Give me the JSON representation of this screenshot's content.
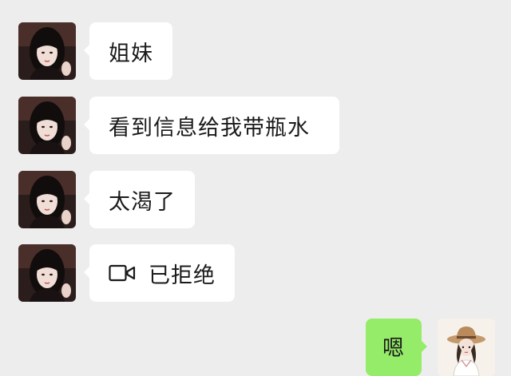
{
  "chat": {
    "messages": [
      {
        "sender": "contact",
        "avatar_icon": "girl-avatar-icon",
        "text": "姐妹"
      },
      {
        "sender": "contact",
        "avatar_icon": "girl-avatar-icon",
        "text": "看到信息给我带瓶水"
      },
      {
        "sender": "contact",
        "avatar_icon": "girl-avatar-icon",
        "text": "太渴了"
      },
      {
        "sender": "contact",
        "avatar_icon": "girl-avatar-icon",
        "type": "video-call",
        "call_icon": "video-camera-icon",
        "text": "已拒绝"
      },
      {
        "sender": "me",
        "avatar_icon": "cartoon-girl-hat-avatar-icon",
        "text": "嗯"
      }
    ]
  },
  "colors": {
    "background": "#ededed",
    "incoming_bubble": "#ffffff",
    "outgoing_bubble": "#95ec69",
    "text": "#1a1a1a"
  }
}
